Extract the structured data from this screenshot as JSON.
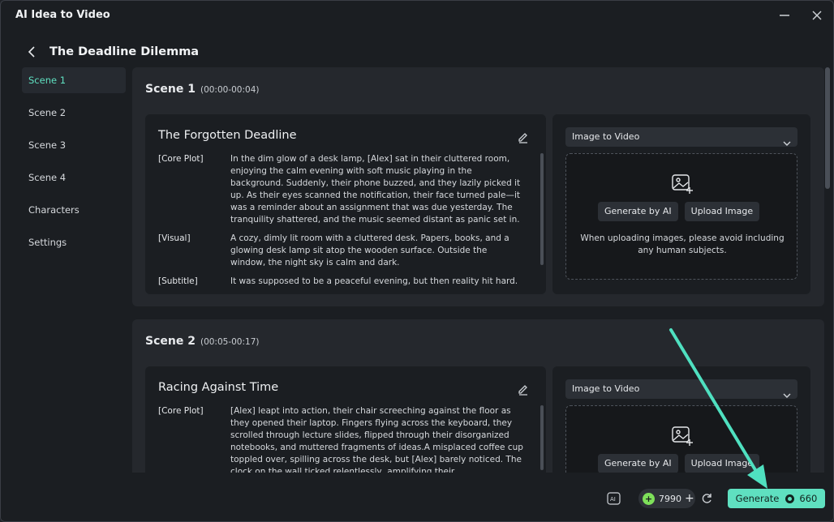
{
  "window": {
    "title": "AI Idea to Video"
  },
  "header": {
    "title": "The Deadline Dilemma"
  },
  "sidebar": {
    "items": [
      {
        "label": "Scene 1",
        "active": true
      },
      {
        "label": "Scene 2"
      },
      {
        "label": "Scene 3"
      },
      {
        "label": "Scene 4"
      },
      {
        "label": "Characters"
      },
      {
        "label": "Settings"
      }
    ]
  },
  "scenes": [
    {
      "name": "Scene 1",
      "time": "(00:00-00:04)",
      "title": "The Forgotten Deadline",
      "rows": [
        {
          "label": "[Core Plot]",
          "text": "In the dim glow of a desk lamp, [Alex] sat in their cluttered room, enjoying the calm evening with soft music playing in the background. Suddenly, their phone buzzed, and they lazily picked it up. As their eyes scanned the notification, their face turned pale—it was a reminder about an assignment that was due yesterday. The tranquility shattered, and the music seemed distant as panic set in."
        },
        {
          "label": "[Visual]",
          "text": "A cozy, dimly lit room with a cluttered desk. Papers, books, and a glowing desk lamp sit atop the wooden surface. Outside the window, the night sky is calm and dark."
        },
        {
          "label": "[Subtitle]",
          "text": "It was supposed to be a peaceful evening, but then reality hit hard."
        }
      ],
      "media": {
        "mode": "Image to Video",
        "generate_label": "Generate by AI",
        "upload_label": "Upload Image",
        "note": "When uploading images, please avoid including any human subjects."
      }
    },
    {
      "name": "Scene 2",
      "time": "(00:05-00:17)",
      "title": "Racing Against Time",
      "rows": [
        {
          "label": "[Core Plot]",
          "text": "[Alex] leapt into action, their chair screeching against the floor as they opened their laptop. Fingers flying across the keyboard, they scrolled through lecture slides, flipped through their disorganized notebooks, and muttered fragments of ideas.A misplaced coffee cup toppled over, spilling across the desk, but [Alex] barely noticed. The clock on the wall ticked relentlessly, amplifying their"
        }
      ],
      "media": {
        "mode": "Image to Video",
        "generate_label": "Generate by AI",
        "upload_label": "Upload Image"
      }
    }
  ],
  "footer": {
    "credits": "7990",
    "generate_label": "Generate",
    "generate_cost": "660"
  },
  "colors": {
    "accent": "#5fe0c0",
    "credit": "#7ee05a",
    "background": "#1b1e22"
  },
  "icons": [
    "minimize-icon",
    "close-icon",
    "back-icon",
    "edit-icon",
    "image-add-icon",
    "chevron-down-icon",
    "ai-image-icon",
    "refresh-icon",
    "credit-icon"
  ]
}
